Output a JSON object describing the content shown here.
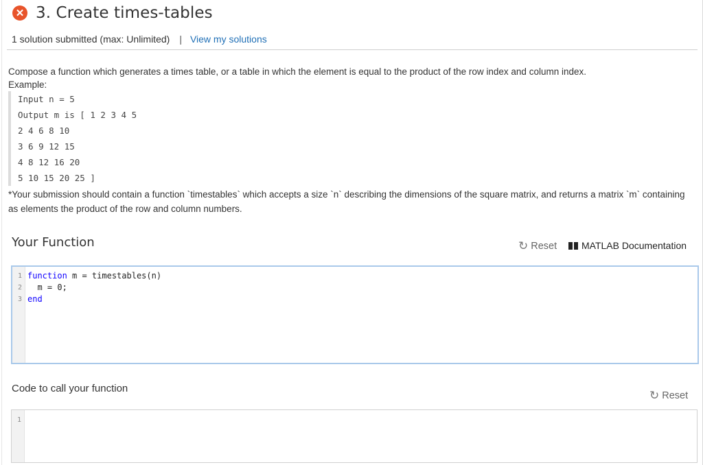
{
  "problem": {
    "title": "3. Create times-tables",
    "submissions": "1 solution submitted (max: Unlimited)",
    "separator": "|",
    "view_link": "View my solutions",
    "status_glyph": "✕",
    "status_color": "#e8542b"
  },
  "description": {
    "text": "Compose a function which generates a times table, or a table in which the element is equal to the product of the row index and column index.",
    "example_label": "Example:",
    "example_lines": [
      "Input n = 5",
      "Output m is [ 1 2 3 4 5",
      "2 4 6 8 10",
      "3 6 9 12 15",
      "4 8 12 16 20",
      "5 10 15 20 25 ]"
    ],
    "note": "*Your submission should contain a function `timestables` which accepts a size `n` describing the dimensions of the square matrix, and returns a matrix `m` containing as elements the product of the row and column numbers."
  },
  "your_function": {
    "title": "Your Function",
    "reset_label": "Reset",
    "doc_label": "MATLAB Documentation",
    "line_numbers": [
      "1",
      "2",
      "3"
    ],
    "code": {
      "line1_kw": "function",
      "line1_rest": " m = timestables(n)",
      "line2": "  m = 0;",
      "line3_kw": "end"
    }
  },
  "call_function": {
    "title": "Code to call your function",
    "reset_label": "Reset",
    "line_numbers": [
      "1"
    ]
  }
}
